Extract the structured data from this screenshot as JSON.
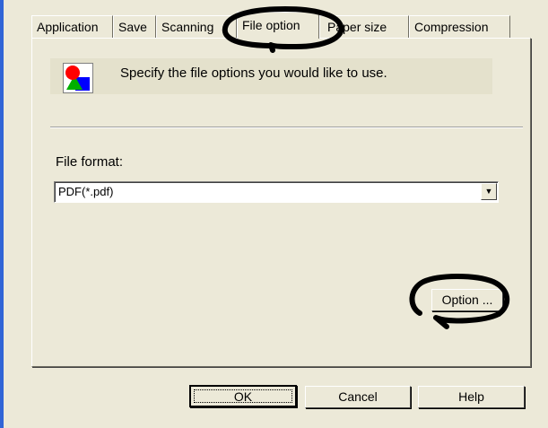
{
  "tabs": [
    {
      "label": "Application"
    },
    {
      "label": "Save"
    },
    {
      "label": "Scanning"
    },
    {
      "label": "File option",
      "active": true
    },
    {
      "label": "Paper size"
    },
    {
      "label": "Compression"
    }
  ],
  "panel": {
    "info_text": "Specify the file options you would like to use.",
    "file_format_label": "File format:",
    "file_format_value": "PDF(*.pdf)",
    "option_button": "Option ..."
  },
  "buttons": {
    "ok": "OK",
    "cancel": "Cancel",
    "help": "Help"
  },
  "colors": {
    "dialog_bg": "#ece9d8",
    "annotation": "#000000",
    "window_edge": "#3165d6"
  }
}
